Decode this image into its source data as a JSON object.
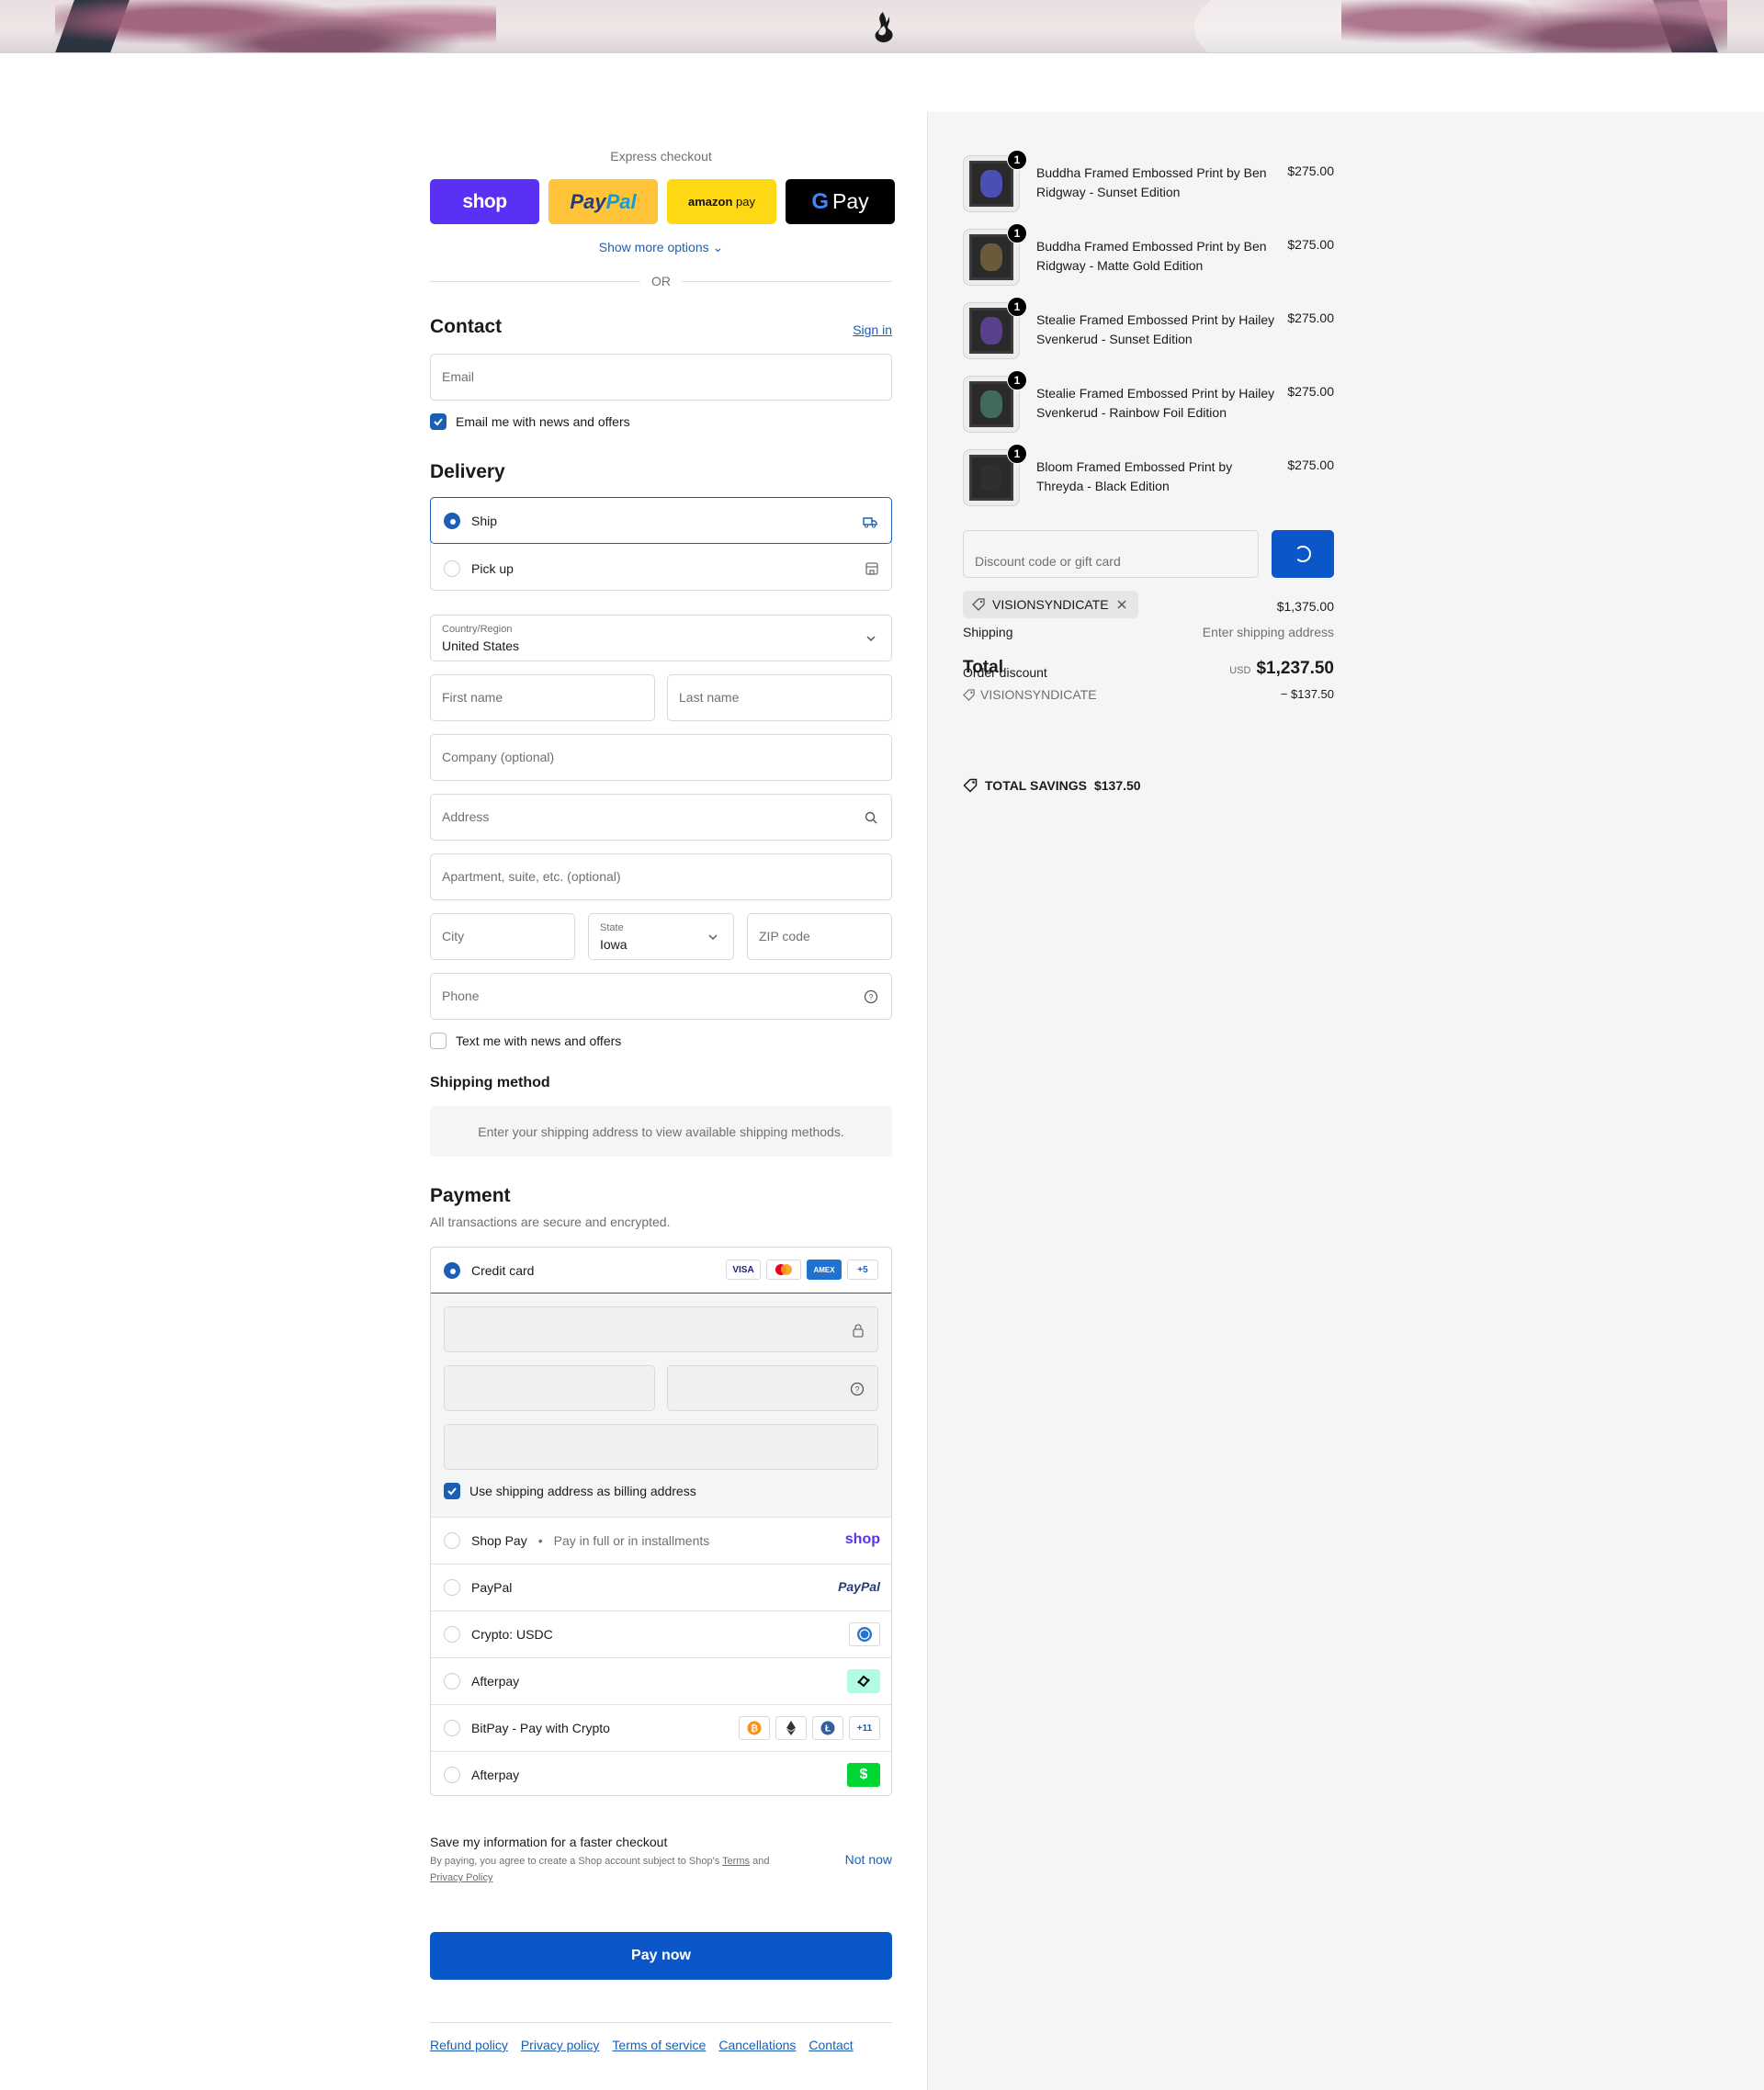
{
  "express": {
    "title": "Express checkout",
    "buttons": [
      "shop",
      "Pay",
      "Pal",
      "amazon",
      "pay",
      "Pay"
    ],
    "more_options": "Show more options",
    "or": "OR"
  },
  "contact": {
    "title": "Contact",
    "sign_in": "Sign in",
    "email_placeholder": "Email",
    "news_checkbox": "Email me with news and offers",
    "news_checked": true
  },
  "delivery": {
    "title": "Delivery",
    "options": [
      {
        "label": "Ship",
        "selected": true
      },
      {
        "label": "Pick up",
        "selected": false
      }
    ],
    "country_label": "Country/Region",
    "country_value": "United States",
    "first_name": "First name",
    "last_name": "Last name",
    "company": "Company (optional)",
    "address": "Address",
    "apartment": "Apartment, suite, etc. (optional)",
    "city": "City",
    "state_label": "State",
    "state_value": "Iowa",
    "zip": "ZIP code",
    "phone": "Phone",
    "text_checkbox": "Text me with news and offers",
    "text_checked": false
  },
  "shipping_method": {
    "title": "Shipping method",
    "message": "Enter your shipping address to view available shipping methods."
  },
  "payment": {
    "title": "Payment",
    "subtitle": "All transactions are secure and encrypted.",
    "credit_card": "Credit card",
    "card_badges": [
      "VISA",
      "AMEX",
      "+5"
    ],
    "billing_checkbox": "Use shipping address as billing address",
    "billing_checked": true,
    "methods": [
      {
        "label": "Shop Pay",
        "detail": "Pay in full or in installments",
        "badge": "shop"
      },
      {
        "label": "PayPal",
        "badge": "PayPal"
      },
      {
        "label": "Crypto: USDC",
        "badge": "usdc"
      },
      {
        "label": "Afterpay",
        "badge": "afterpay"
      },
      {
        "label": "BitPay - Pay with Crypto",
        "badge": "+11"
      },
      {
        "label": "Afterpay",
        "badge": "$"
      }
    ]
  },
  "save": {
    "title": "Save my information for a faster checkout",
    "text_prefix": "By paying, you agree to create a Shop account subject to Shop's",
    "terms": "Terms",
    "and": "and",
    "privacy": "Privacy Policy",
    "not_now": "Not now"
  },
  "pay_now": "Pay now",
  "footer_links": [
    "Refund policy",
    "Privacy policy",
    "Terms of service",
    "Cancellations",
    "Contact"
  ],
  "summary": {
    "items": [
      {
        "qty": "1",
        "name": "Buddha Framed Embossed Print by Ben Ridgway - Sunset Edition",
        "price": "$275.00",
        "art_color": "#4a4fb5"
      },
      {
        "qty": "1",
        "name": "Buddha Framed Embossed Print by Ben Ridgway - Matte Gold Edition",
        "price": "$275.00",
        "art_color": "#6b5a3a"
      },
      {
        "qty": "1",
        "name": "Stealie Framed Embossed Print by Hailey Svenkerud - Sunset Edition",
        "price": "$275.00",
        "art_color": "#5a3f8a"
      },
      {
        "qty": "1",
        "name": "Stealie Framed Embossed Print by Hailey Svenkerud - Rainbow Foil Edition",
        "price": "$275.00",
        "art_color": "#3f6a5c"
      },
      {
        "qty": "1",
        "name": "Bloom Framed Embossed Print by Threyda - Black Edition",
        "price": "$275.00",
        "art_color": "#2f2f2f"
      }
    ],
    "discount_placeholder": "Discount code or gift card",
    "applied_code": "VISIONSYNDICATE",
    "subtotal_value": "$1,375.00",
    "shipping_label": "Shipping",
    "shipping_value": "Enter shipping address",
    "total_label": "Total",
    "currency": "USD",
    "total_value": "$1,237.50",
    "order_discount_label": "Order discount",
    "order_discount_code": "VISIONSYNDICATE",
    "order_discount_value": "− $137.50",
    "total_savings_label": "TOTAL SAVINGS",
    "total_savings_value": "$137.50"
  }
}
